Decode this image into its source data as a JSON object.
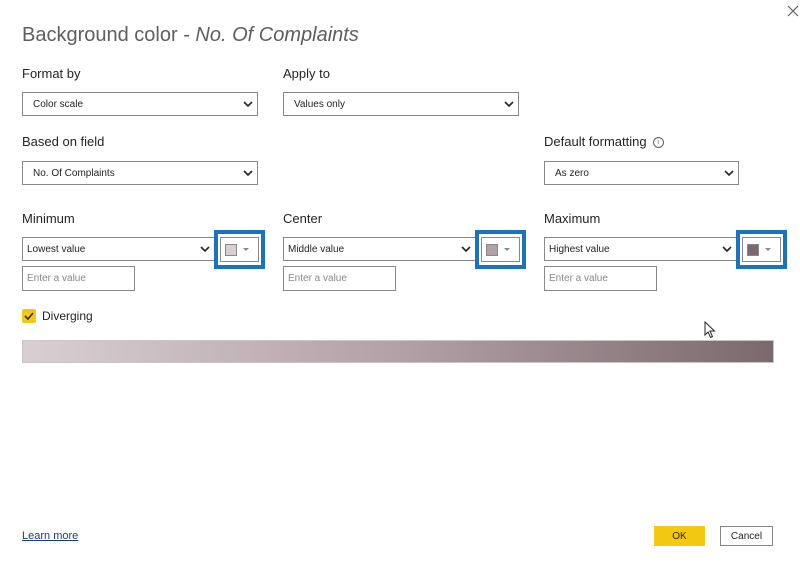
{
  "dialog": {
    "title_prefix": "Background color - ",
    "title_field": "No. Of Complaints"
  },
  "format_by": {
    "label": "Format by",
    "value": "Color scale"
  },
  "apply_to": {
    "label": "Apply to",
    "value": "Values only"
  },
  "based_on_field": {
    "label": "Based on field",
    "value": "No. Of Complaints"
  },
  "default_formatting": {
    "label": "Default formatting",
    "info_icon": "ⓘ",
    "value": "As zero"
  },
  "minimum": {
    "label": "Minimum",
    "value": "Lowest value",
    "placeholder": "Enter a value",
    "color": "#d9cfd2"
  },
  "center": {
    "label": "Center",
    "value": "Middle value",
    "placeholder": "Enter a value",
    "color": "#b2a1a6"
  },
  "maximum": {
    "label": "Maximum",
    "value": "Highest value",
    "placeholder": "Enter a value",
    "color": "#7a6a6e"
  },
  "diverging": {
    "label": "Diverging",
    "checked": true
  },
  "footer": {
    "learn_more": "Learn more",
    "ok": "OK",
    "cancel": "Cancel"
  },
  "colors": {
    "accent": "#f2c811",
    "highlight": "#1a73c0"
  }
}
